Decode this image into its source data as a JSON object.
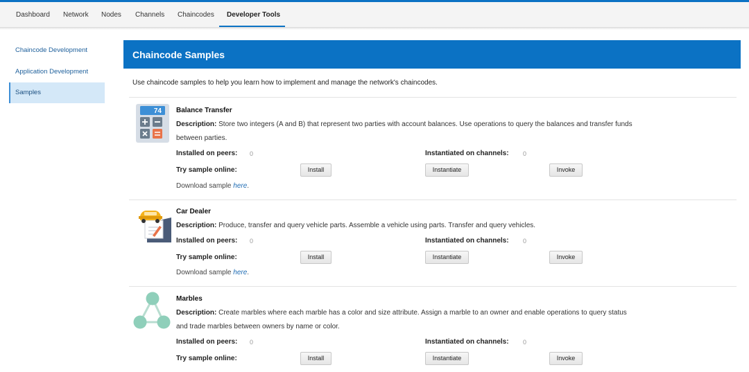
{
  "nav": {
    "tabs": [
      {
        "label": "Dashboard"
      },
      {
        "label": "Network"
      },
      {
        "label": "Nodes"
      },
      {
        "label": "Channels"
      },
      {
        "label": "Chaincodes"
      },
      {
        "label": "Developer Tools",
        "active": true
      }
    ]
  },
  "sidebar": {
    "items": [
      {
        "label": "Chaincode Development"
      },
      {
        "label": "Application Development"
      },
      {
        "label": "Samples",
        "active": true
      }
    ]
  },
  "main": {
    "title": "Chaincode Samples",
    "intro": "Use chaincode samples to help you learn how to implement and manage the network's chaincodes.",
    "labels": {
      "description": "Description:",
      "installed_on_peers": "Installed on peers:",
      "instantiated_on_channels": "Instantiated on channels:",
      "try_sample_online": "Try sample online:",
      "download_prefix": "Download sample",
      "download_link": "here",
      "download_suffix": ".",
      "install": "Install",
      "instantiate": "Instantiate",
      "invoke": "Invoke"
    },
    "samples": [
      {
        "name": "Balance Transfer",
        "icon": "calculator-icon",
        "icon_number": "74",
        "description_line1": "Store two integers (A and B) that represent two parties with account balances. Use operations to query the balances and transfer funds",
        "description_line2": "between parties.",
        "installed_on_peers": "0",
        "instantiated_on_channels": "0"
      },
      {
        "name": "Car Dealer",
        "icon": "car-dealer-icon",
        "description_line1": "Produce, transfer and query vehicle parts. Assemble a vehicle using parts. Transfer and query vehicles.",
        "installed_on_peers": "0",
        "instantiated_on_channels": "0"
      },
      {
        "name": "Marbles",
        "icon": "marbles-icon",
        "description_line1": "Create marbles where each marble has a color and size attribute. Assign a marble to an owner and enable operations to query status",
        "description_line2": "and trade marbles between owners by name or color.",
        "installed_on_peers": "0",
        "instantiated_on_channels": "0"
      }
    ]
  },
  "colors": {
    "primary": "#0b72c4",
    "sidebar_active_bg": "#d4e8f8",
    "link": "#1d6bb3"
  }
}
